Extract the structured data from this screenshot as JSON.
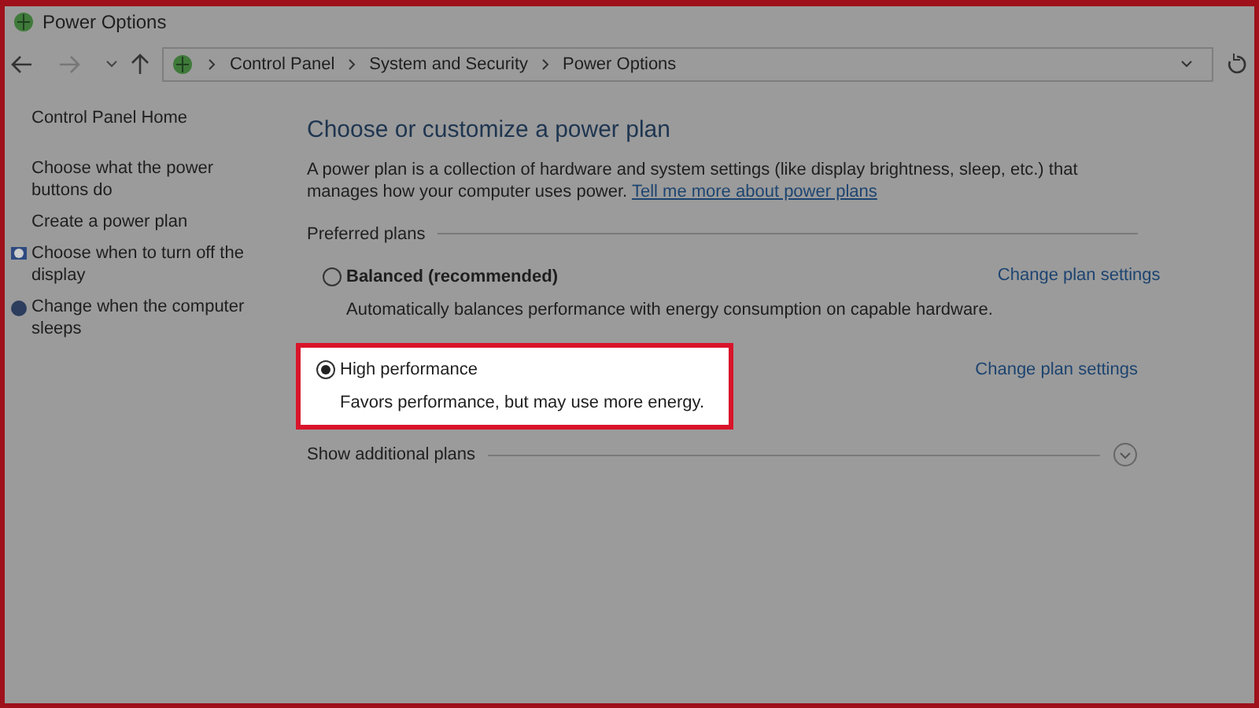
{
  "window": {
    "title": "Power Options"
  },
  "breadcrumb": [
    "Control Panel",
    "System and Security",
    "Power Options"
  ],
  "sidebar": {
    "items": [
      {
        "label": "Control Panel Home",
        "kind": "plain"
      },
      {
        "label": "Choose what the power buttons do",
        "kind": "plain"
      },
      {
        "label": "Create a power plan",
        "kind": "plain"
      },
      {
        "label": "Choose when to turn off the display",
        "kind": "display"
      },
      {
        "label": "Change when the computer sleeps",
        "kind": "sleep"
      }
    ]
  },
  "main": {
    "heading": "Choose or customize a power plan",
    "description": "A power plan is a collection of hardware and system settings (like display brightness, sleep, etc.) that manages how your computer uses power.",
    "link": "Tell me more about power plans",
    "section": "Preferred plans",
    "plans": [
      {
        "name": "Balanced (recommended)",
        "bold": true,
        "description": "Automatically balances performance with energy consumption on capable hardware.",
        "selected": false,
        "highlighted": false,
        "action": "Change plan settings"
      },
      {
        "name": "High performance",
        "bold": false,
        "description": "Favors performance, but may use more energy.",
        "selected": true,
        "highlighted": true,
        "action": "Change plan settings"
      }
    ],
    "more": "Show additional plans"
  }
}
